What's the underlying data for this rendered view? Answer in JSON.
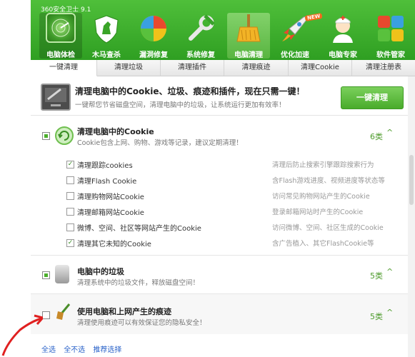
{
  "app": {
    "title": "360安全卫士 9.1",
    "badge_new": "NEW"
  },
  "toolbar": [
    {
      "label": "电脑体检",
      "icon": "radar-icon"
    },
    {
      "label": "木马查杀",
      "icon": "horse-shield-icon"
    },
    {
      "label": "漏洞修复",
      "icon": "patch-icon"
    },
    {
      "label": "系统修复",
      "icon": "wrench-icon"
    },
    {
      "label": "电脑清理",
      "icon": "broom-icon"
    },
    {
      "label": "优化加速",
      "icon": "rocket-icon"
    },
    {
      "label": "电脑专家",
      "icon": "doctor-icon"
    },
    {
      "label": "软件管家",
      "icon": "apps-icon"
    }
  ],
  "tabs": [
    "一键清理",
    "清理垃圾",
    "清理插件",
    "清理痕迹",
    "清理Cookie",
    "清理注册表"
  ],
  "banner": {
    "title": "清理电脑中的Cookie、垃圾、痕迹和插件，现在只需一键！",
    "subtitle": "一键帮您节省磁盘空间，清理电脑中的垃圾，让系统运行更加有效率！",
    "button": "一键清理"
  },
  "sections": [
    {
      "title": "清理电脑中的Cookie",
      "desc": "Cookie包含上网、购物、游戏等记录，建议定期清理！",
      "count": "6类",
      "items": [
        {
          "label": "清理跟踪cookies",
          "checked": true,
          "desc": "清理后防止搜索引擎跟踪搜索行为"
        },
        {
          "label": "清理Flash Cookie",
          "checked": false,
          "desc": "含Flash游戏进度、视频进度等状态等"
        },
        {
          "label": "清理购物网站Cookie",
          "checked": false,
          "desc": "访问常见购物网站产生的Cookie"
        },
        {
          "label": "清理邮箱网站Cookie",
          "checked": false,
          "desc": "登录邮箱网站时产生的Cookie"
        },
        {
          "label": "微博、空间、社区等网站产生的Cookie",
          "checked": false,
          "desc": "访问微博、空间、社区生成的Cookie"
        },
        {
          "label": "清理其它未知的Cookie",
          "checked": true,
          "desc": "含广告植入、其它FlashCookie等"
        }
      ]
    },
    {
      "title": "电脑中的垃圾",
      "desc": "清理系统中的垃圾文件，释放磁盘空间！",
      "count": "5类"
    },
    {
      "title": "使用电脑和上网产生的痕迹",
      "desc": "清理使用痕迹可以有效保证您的隐私安全！",
      "count": "5类"
    }
  ],
  "footer": {
    "select_all": "全选",
    "select_none": "全不选",
    "recommend": "推荐选择"
  },
  "chevron_up": "^",
  "colors": {
    "green": "#3aa428",
    "link": "#2a62c9",
    "arrow": "#e02020"
  }
}
